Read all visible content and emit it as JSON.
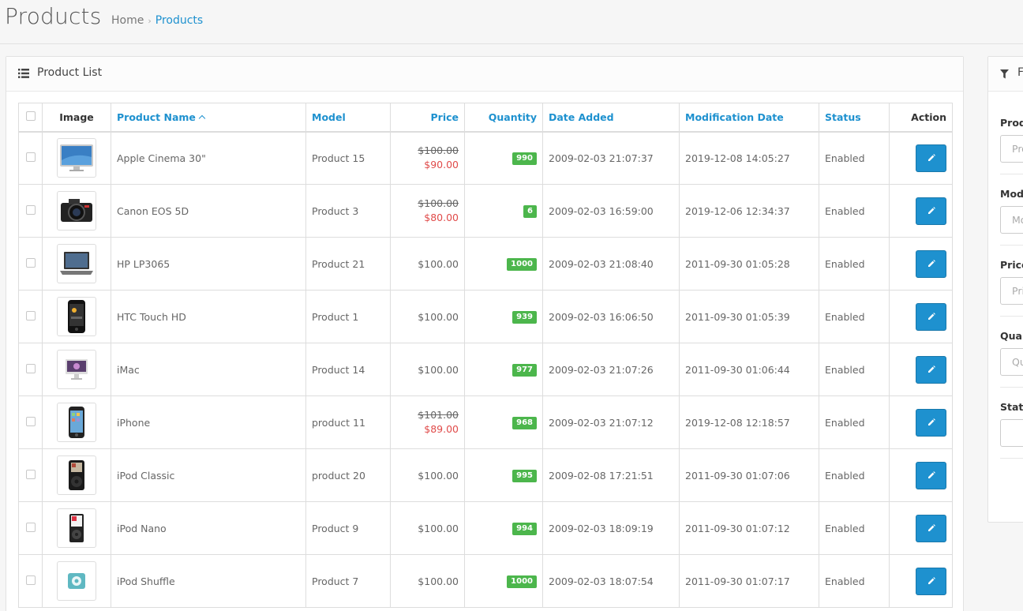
{
  "header": {
    "title": "Products",
    "breadcrumb": [
      {
        "label": "Home"
      },
      {
        "label": "Products"
      }
    ]
  },
  "panel": {
    "title": "Product List",
    "columns": {
      "image": "Image",
      "name": "Product Name",
      "model": "Model",
      "price": "Price",
      "quantity": "Quantity",
      "date_added": "Date Added",
      "date_modified": "Modification Date",
      "status": "Status",
      "action": "Action"
    },
    "rows": [
      {
        "name": "Apple Cinema 30\"",
        "model": "Product 15",
        "price": "$100.00",
        "special": "$90.00",
        "quantity": "990",
        "date_added": "2009-02-03 21:07:37",
        "date_modified": "2019-12-08 14:05:27",
        "status": "Enabled",
        "image_icon": "monitor-icon"
      },
      {
        "name": "Canon EOS 5D",
        "model": "Product 3",
        "price": "$100.00",
        "special": "$80.00",
        "quantity": "6",
        "date_added": "2009-02-03 16:59:00",
        "date_modified": "2019-12-06 12:34:37",
        "status": "Enabled",
        "image_icon": "camera-icon"
      },
      {
        "name": "HP LP3065",
        "model": "Product 21",
        "price": "$100.00",
        "special": null,
        "quantity": "1000",
        "date_added": "2009-02-03 21:08:40",
        "date_modified": "2011-09-30 01:05:28",
        "status": "Enabled",
        "image_icon": "laptop-icon"
      },
      {
        "name": "HTC Touch HD",
        "model": "Product 1",
        "price": "$100.00",
        "special": null,
        "quantity": "939",
        "date_added": "2009-02-03 16:06:50",
        "date_modified": "2011-09-30 01:05:39",
        "status": "Enabled",
        "image_icon": "smartphone-icon"
      },
      {
        "name": "iMac",
        "model": "Product 14",
        "price": "$100.00",
        "special": null,
        "quantity": "977",
        "date_added": "2009-02-03 21:07:26",
        "date_modified": "2011-09-30 01:06:44",
        "status": "Enabled",
        "image_icon": "imac-icon"
      },
      {
        "name": "iPhone",
        "model": "product 11",
        "price": "$101.00",
        "special": "$89.00",
        "quantity": "968",
        "date_added": "2009-02-03 21:07:12",
        "date_modified": "2019-12-08 12:18:57",
        "status": "Enabled",
        "image_icon": "iphone-icon"
      },
      {
        "name": "iPod Classic",
        "model": "product 20",
        "price": "$100.00",
        "special": null,
        "quantity": "995",
        "date_added": "2009-02-08 17:21:51",
        "date_modified": "2011-09-30 01:07:06",
        "status": "Enabled",
        "image_icon": "ipod-classic-icon"
      },
      {
        "name": "iPod Nano",
        "model": "Product 9",
        "price": "$100.00",
        "special": null,
        "quantity": "994",
        "date_added": "2009-02-03 18:09:19",
        "date_modified": "2011-09-30 01:07:12",
        "status": "Enabled",
        "image_icon": "ipod-nano-icon"
      },
      {
        "name": "iPod Shuffle",
        "model": "Product 7",
        "price": "$100.00",
        "special": null,
        "quantity": "1000",
        "date_added": "2009-02-03 18:07:54",
        "date_modified": "2011-09-30 01:07:17",
        "status": "Enabled",
        "image_icon": "ipod-shuffle-icon"
      }
    ]
  },
  "filter": {
    "title": "F",
    "fields": [
      {
        "label": "Prod",
        "placeholder": "Pro"
      },
      {
        "label": "Mod",
        "placeholder": "Mo"
      },
      {
        "label": "Price",
        "placeholder": "Pri"
      },
      {
        "label": "Quar",
        "placeholder": "Qu"
      },
      {
        "label": "Statu",
        "placeholder": ""
      }
    ]
  },
  "colors": {
    "accent": "#1e91cf",
    "badge_green": "#4cb64c",
    "special_red": "#e04b4a"
  }
}
